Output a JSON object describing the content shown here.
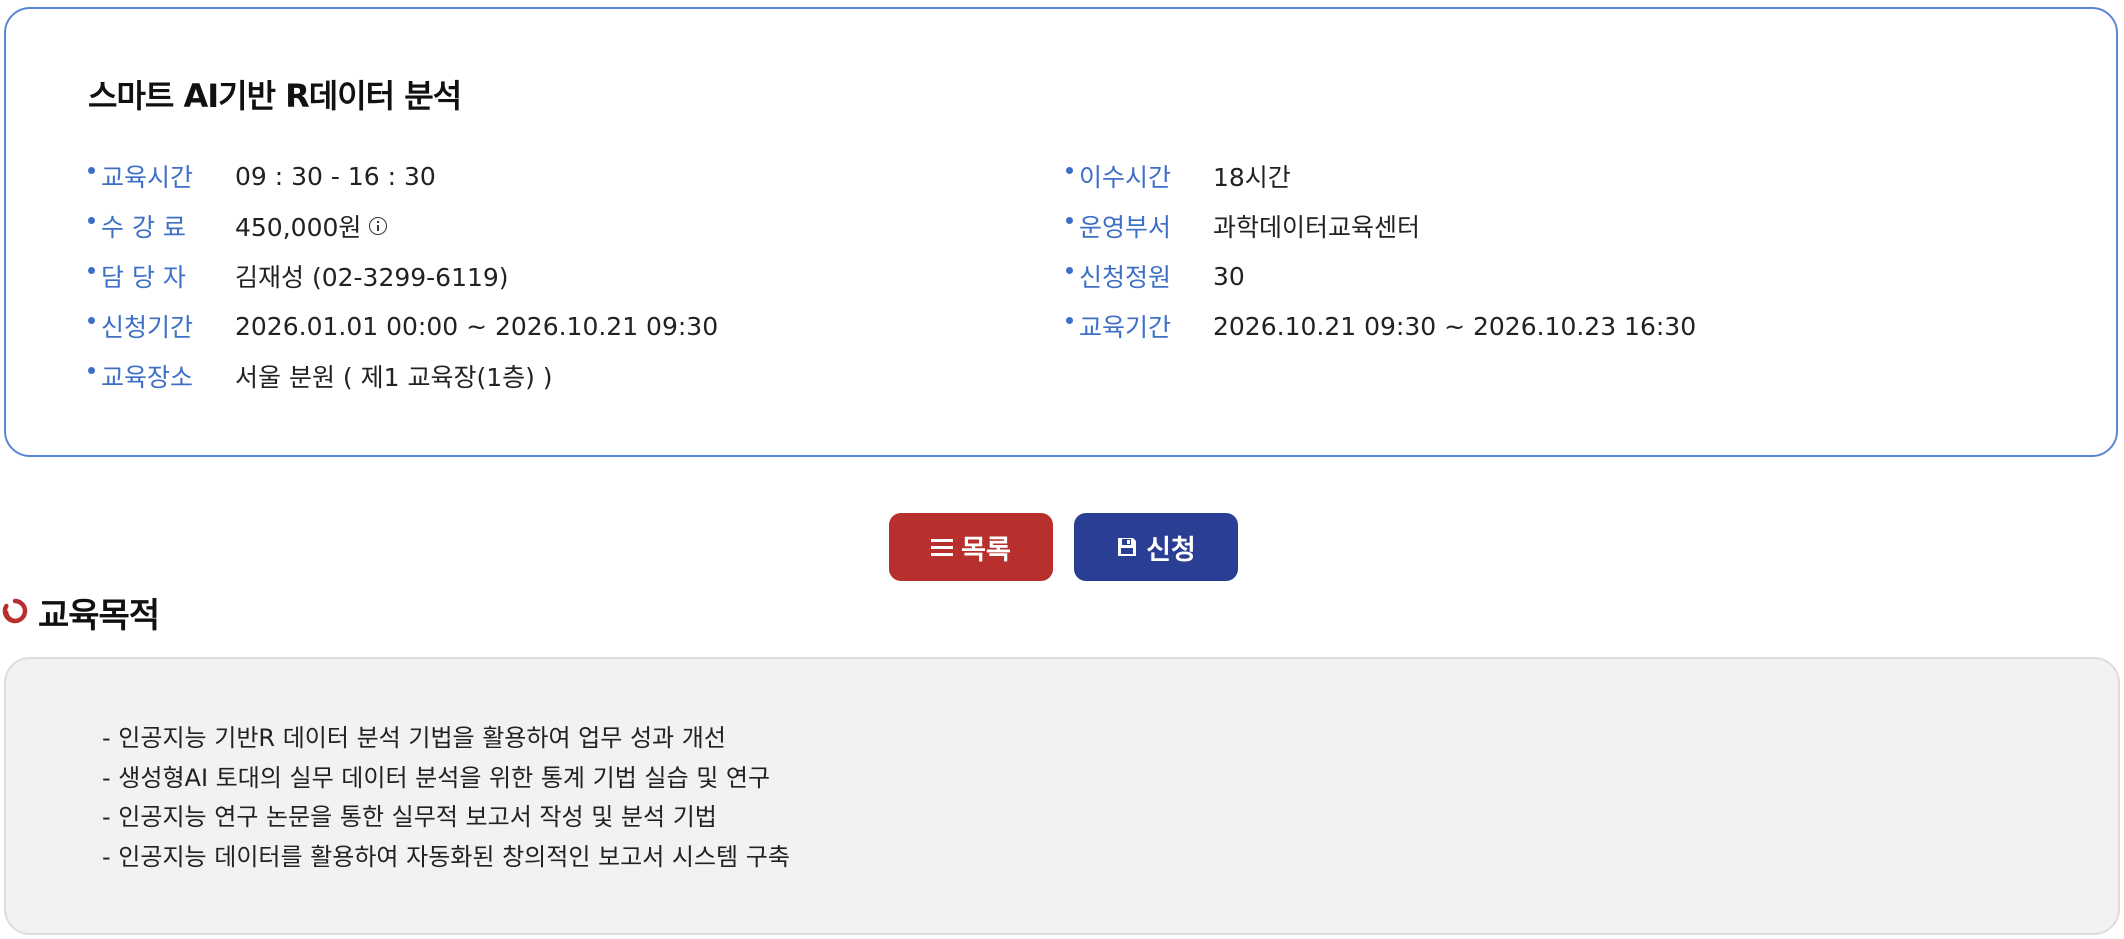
{
  "course": {
    "title": "스마트 AI기반 R데이터 분석",
    "left_rows": [
      {
        "label": "교육시간",
        "value": "09 : 30 - 16 : 30"
      },
      {
        "label": "수 강 료",
        "value": "450,000원"
      },
      {
        "label": "담 당 자",
        "value": "김재성 (02-3299-6119)"
      },
      {
        "label": "신청기간",
        "value": "2026.01.01 00:00 ~ 2026.10.21 09:30"
      },
      {
        "label": "교육장소",
        "value": "서울 분원 ( 제1 교육장(1층) )"
      }
    ],
    "right_rows": [
      {
        "label": "이수시간",
        "value": "18시간"
      },
      {
        "label": "운영부서",
        "value": "과학데이터교육센터"
      },
      {
        "label": "신청정원",
        "value": "30"
      },
      {
        "label": "교육기간",
        "value": "2026.10.21 09:30 ~ 2026.10.23 16:30"
      }
    ],
    "fee_info_icon": "info-circle-icon"
  },
  "actions": {
    "list_label": "목록",
    "list_icon": "menu-lines-icon",
    "apply_label": "신청",
    "apply_icon": "save-disk-icon",
    "list_color": "#b8302e",
    "apply_color": "#2a3e94"
  },
  "purpose": {
    "title": "교육목적",
    "title_icon": "refresh-circle-icon",
    "items": [
      "- 인공지능 기반R 데이터 분석 기법을 활용하여 업무 성과 개선",
      "- 생성형AI 토대의 실무 데이터 분석을 위한 통계 기법 실습 및 연구",
      "- 인공지능 연구 논문을 통한 실무적 보고서 작성 및 분석 기법",
      "- 인공지능 데이터를 활용하여 자동화된 창의적인 보고서 시스템 구축"
    ]
  },
  "colors": {
    "accent_blue": "#3d6fc7",
    "card_border": "#5b86d3",
    "section_icon_red": "#b8302e"
  }
}
